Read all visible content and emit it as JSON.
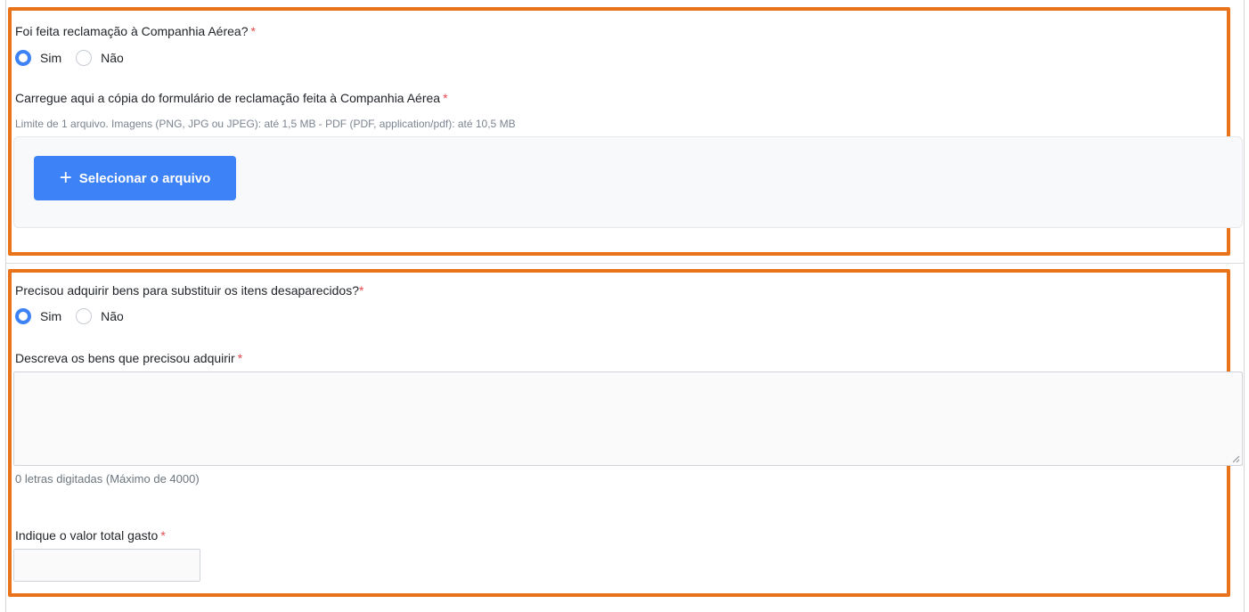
{
  "section1": {
    "question": "Foi feita reclamação à Companhia Aérea?",
    "required_mark": "*",
    "options": [
      {
        "label": "Sim",
        "checked": true
      },
      {
        "label": "Não",
        "checked": false
      }
    ],
    "upload_label": "Carregue aqui a cópia do formulário de reclamação feita à Companhia Aérea",
    "upload_hint": "Limite de 1 arquivo. Imagens (PNG, JPG ou JPEG): até 1,5 MB - PDF (PDF, application/pdf): até 10,5 MB",
    "upload_button": "Selecionar o arquivo"
  },
  "section2": {
    "question": "Precisou adquirir bens para substituir os itens desaparecidos?",
    "required_mark": "*",
    "options": [
      {
        "label": "Sim",
        "checked": true
      },
      {
        "label": "Não",
        "checked": false
      }
    ],
    "describe_label": "Descreva os bens que precisou adquirir",
    "describe_value": "",
    "char_counter": "0 letras digitadas (Máximo de 4000)",
    "value_label": "Indique o valor total gasto",
    "value_input": ""
  },
  "colors": {
    "highlight": "#e8731a",
    "accent": "#3d82f6",
    "required": "#e5484d"
  },
  "icons": {
    "upload_button_icon": "plus-icon",
    "textarea_grip": "resize-grip-icon"
  }
}
